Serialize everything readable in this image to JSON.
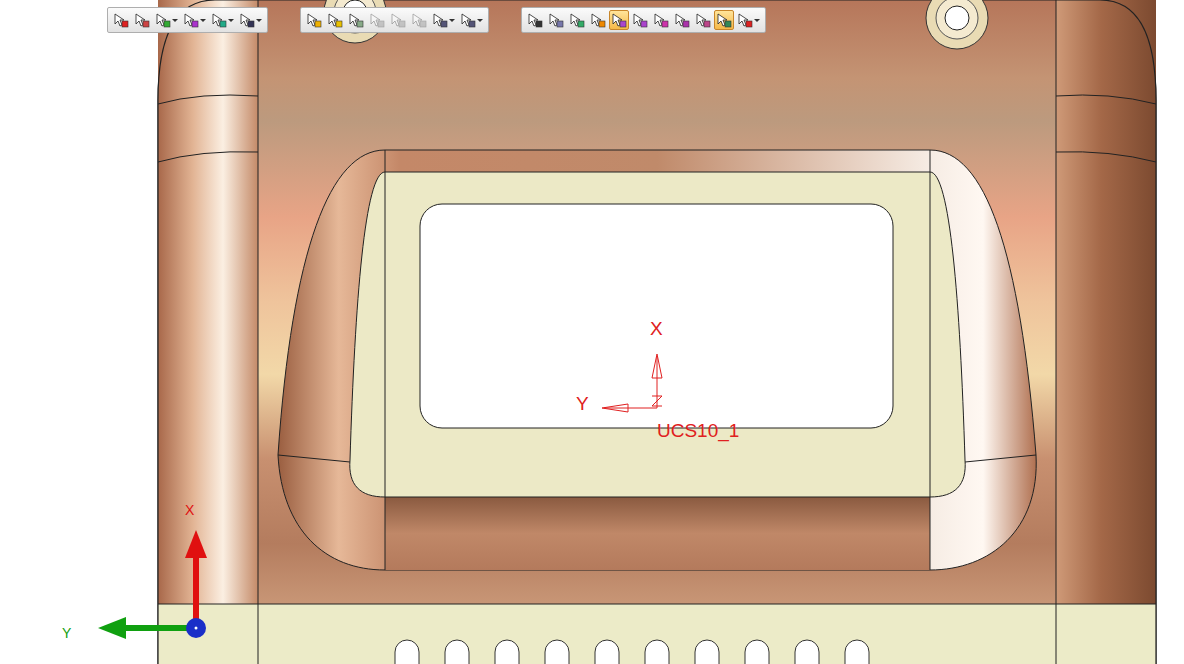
{
  "toolbars": [
    {
      "buttons": [
        {
          "kind": "plain",
          "selected": false,
          "disabled": false
        },
        {
          "kind": "plain",
          "selected": false,
          "disabled": false
        },
        {
          "kind": "split",
          "selected": false,
          "disabled": false
        },
        {
          "kind": "split",
          "selected": false,
          "disabled": false
        },
        {
          "kind": "split",
          "selected": false,
          "disabled": false
        },
        {
          "kind": "split",
          "selected": false,
          "disabled": false
        }
      ]
    },
    {
      "buttons": [
        {
          "kind": "plain",
          "selected": false,
          "disabled": false
        },
        {
          "kind": "plain",
          "selected": false,
          "disabled": false
        },
        {
          "kind": "plain",
          "selected": false,
          "disabled": false
        },
        {
          "kind": "plain",
          "selected": false,
          "disabled": true
        },
        {
          "kind": "plain",
          "selected": false,
          "disabled": true
        },
        {
          "kind": "plain",
          "selected": false,
          "disabled": true
        },
        {
          "kind": "split",
          "selected": false,
          "disabled": false
        },
        {
          "kind": "split",
          "selected": false,
          "disabled": false
        }
      ]
    },
    {
      "buttons": [
        {
          "kind": "plain",
          "selected": false,
          "disabled": false
        },
        {
          "kind": "plain",
          "selected": false,
          "disabled": false
        },
        {
          "kind": "plain",
          "selected": false,
          "disabled": false
        },
        {
          "kind": "plain",
          "selected": false,
          "disabled": false
        },
        {
          "kind": "plain",
          "selected": true,
          "disabled": false
        },
        {
          "kind": "plain",
          "selected": false,
          "disabled": false
        },
        {
          "kind": "plain",
          "selected": false,
          "disabled": false
        },
        {
          "kind": "plain",
          "selected": false,
          "disabled": false
        },
        {
          "kind": "plain",
          "selected": false,
          "disabled": false
        },
        {
          "kind": "plain",
          "selected": true,
          "disabled": false
        },
        {
          "kind": "split",
          "selected": false,
          "disabled": false
        }
      ]
    }
  ],
  "ucs": {
    "name": "UCS10_1",
    "x_label": "X",
    "y_label": "Y"
  },
  "triad": {
    "x_label": "X",
    "y_label": "Y"
  }
}
